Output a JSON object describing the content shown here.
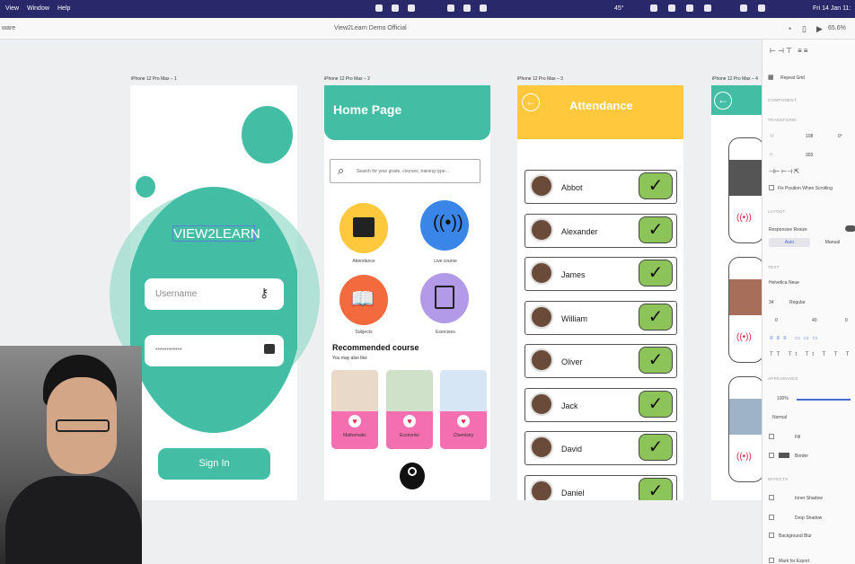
{
  "menubar": {
    "left_items": [
      "View",
      "Window",
      "Help"
    ],
    "clock": "Fri 14 Jan 11:",
    "zoom_status": "45°"
  },
  "appbar": {
    "left_label": "ware",
    "doc_title": "View2Learn Demo Official",
    "zoom": "65.6%"
  },
  "artboard_labels": [
    "iPhone 12 Pro Max – 1",
    "iPhone 12 Pro Max – 2",
    "iPhone 12 Pro Max – 3",
    "iPhone 12 Pro Max – 4"
  ],
  "login": {
    "brand": "VIEW2LEARN",
    "username_placeholder": "Username",
    "password_value": "••••••••••••",
    "signin_label": "Sign In"
  },
  "home": {
    "title": "Home Page",
    "search_placeholder": "Search for your grade, courses, training type...",
    "features": [
      {
        "label": "Attendance",
        "color": "#ffc83d"
      },
      {
        "label": "Live course",
        "color": "#3a86e8"
      },
      {
        "label": "Subjects",
        "color": "#f26a3d"
      },
      {
        "label": "Exercises",
        "color": "#b39ae8"
      }
    ],
    "recommended_title": "Recommended course",
    "recommended_sub": "You may also like",
    "courses": [
      "Mathematic",
      "Economic",
      "Chemistry"
    ]
  },
  "attendance": {
    "title": "Attendance",
    "students": [
      "Abbot",
      "Alexander",
      "James",
      "William",
      "Oliver",
      "Jack",
      "David",
      "Daniel"
    ],
    "check": "✓"
  },
  "panel": {
    "repeat_grid": "Repeat Grid",
    "component": "COMPONENT",
    "transform": "TRANSFORM",
    "w": "108",
    "h": "303",
    "rotation": "0°",
    "fix_position": "Fix Position When Scrolling",
    "layout": "LAYOUT",
    "responsive_resize": "Responsive Resize",
    "auto": "Auto",
    "manual": "Manual",
    "text": "TEXT",
    "font": "Helvetica Neue",
    "font_size": "34",
    "font_weight": "Regular",
    "line_spacing": "40",
    "char_spacing": "0",
    "para_spacing": "0",
    "appearance": "APPEARANCE",
    "opacity": "100%",
    "blend": "Normal",
    "fill": "Fill",
    "border": "Border",
    "effects": "EFFECTS",
    "inner_shadow": "Inner Shadow",
    "drop_shadow": "Drop Shadow",
    "background_blur": "Background Blur",
    "mark_export": "Mark for Export"
  },
  "colors": {
    "teal": "#43bea4",
    "amber": "#ffc83d",
    "green_check": "#8cc45a",
    "menubar": "#28286b"
  }
}
